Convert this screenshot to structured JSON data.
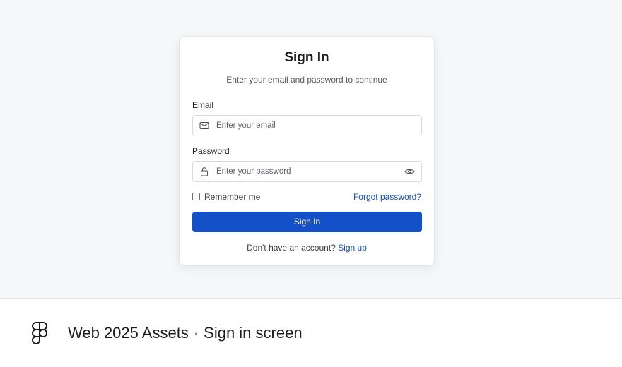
{
  "signin_card": {
    "title": "Sign In",
    "subtitle": "Enter your email and password to continue",
    "email": {
      "label": "Email",
      "placeholder": "Enter your email",
      "icon": "mail-icon"
    },
    "password": {
      "label": "Password",
      "placeholder": "Enter your password",
      "icon": "lock-icon",
      "toggle_icon": "eye-icon"
    },
    "remember_label": "Remember me",
    "remember_checked": false,
    "forgot_label": "Forgot password?",
    "submit_label": "Sign In",
    "signup_prompt": "Don't have an account?",
    "signup_link": "Sign up"
  },
  "caption": {
    "project": "Web 2025 Assets",
    "separator": "·",
    "screen": "Sign in screen",
    "logo_icon": "figma-logo-icon"
  },
  "colors": {
    "primary": "#1450c8",
    "link": "#1551c8",
    "canvas_bg": "#f6f7f9"
  }
}
